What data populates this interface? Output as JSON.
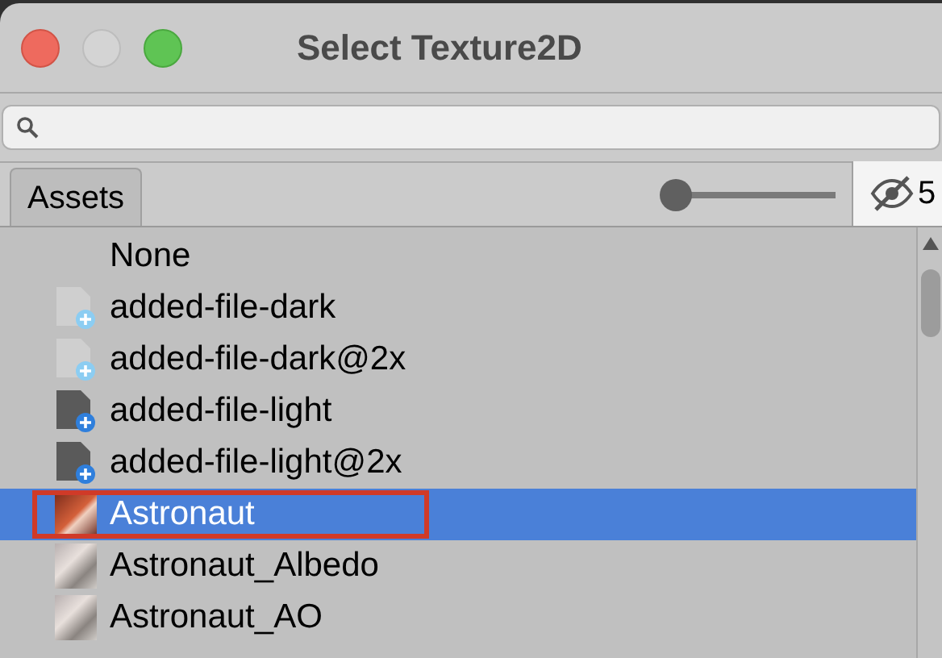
{
  "window": {
    "title": "Select Texture2D"
  },
  "tabs": [
    {
      "label": "Assets",
      "selected": true
    }
  ],
  "size_slider": {
    "level": 0.03
  },
  "hidden_count": "5",
  "items": [
    {
      "name": "None",
      "kind": "none",
      "selected": false,
      "highlighted": false
    },
    {
      "name": "added-file-dark",
      "kind": "file-dark",
      "selected": false,
      "highlighted": false
    },
    {
      "name": "added-file-dark@2x",
      "kind": "file-dark",
      "selected": false,
      "highlighted": false
    },
    {
      "name": "added-file-light",
      "kind": "file-light",
      "selected": false,
      "highlighted": false
    },
    {
      "name": "added-file-light@2x",
      "kind": "file-light",
      "selected": false,
      "highlighted": false
    },
    {
      "name": "Astronaut",
      "kind": "texture",
      "selected": true,
      "highlighted": true
    },
    {
      "name": "Astronaut_Albedo",
      "kind": "texture",
      "selected": false,
      "highlighted": false
    },
    {
      "name": "Astronaut_AO",
      "kind": "texture",
      "selected": false,
      "highlighted": false
    }
  ]
}
